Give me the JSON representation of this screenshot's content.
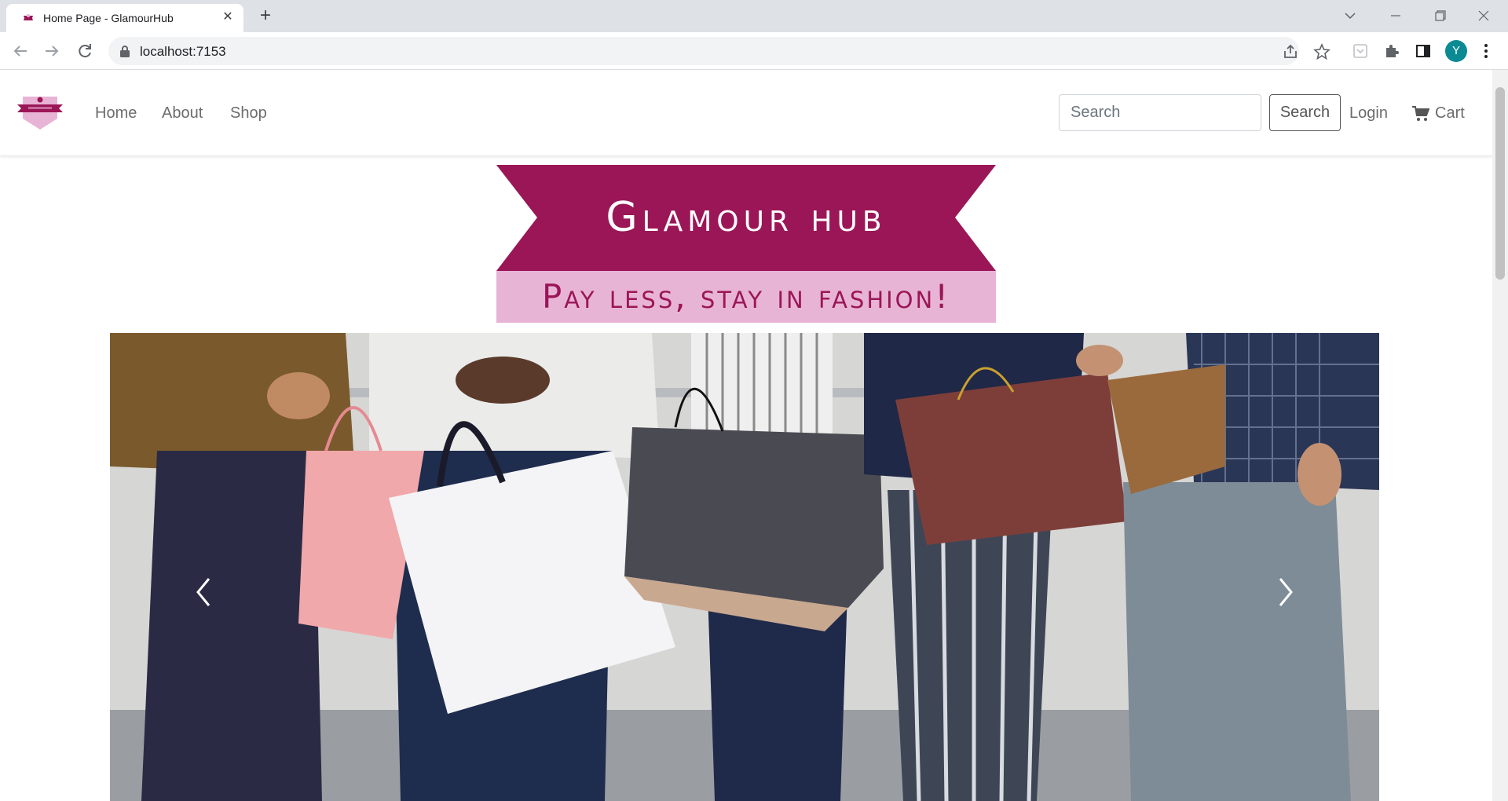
{
  "browser": {
    "tab_title": "Home Page - GlamourHub",
    "url": "localhost:7153",
    "profile_initial": "Y"
  },
  "navbar": {
    "links": [
      "Home",
      "About",
      "Shop"
    ],
    "search_placeholder": "Search",
    "search_button": "Search",
    "login": "Login",
    "cart": "Cart"
  },
  "banner": {
    "title": "Glamour hub",
    "tagline": "Pay less, stay in fashion!"
  },
  "colors": {
    "brand_magenta": "#9b1657",
    "brand_pink": "#e8b4d6"
  }
}
